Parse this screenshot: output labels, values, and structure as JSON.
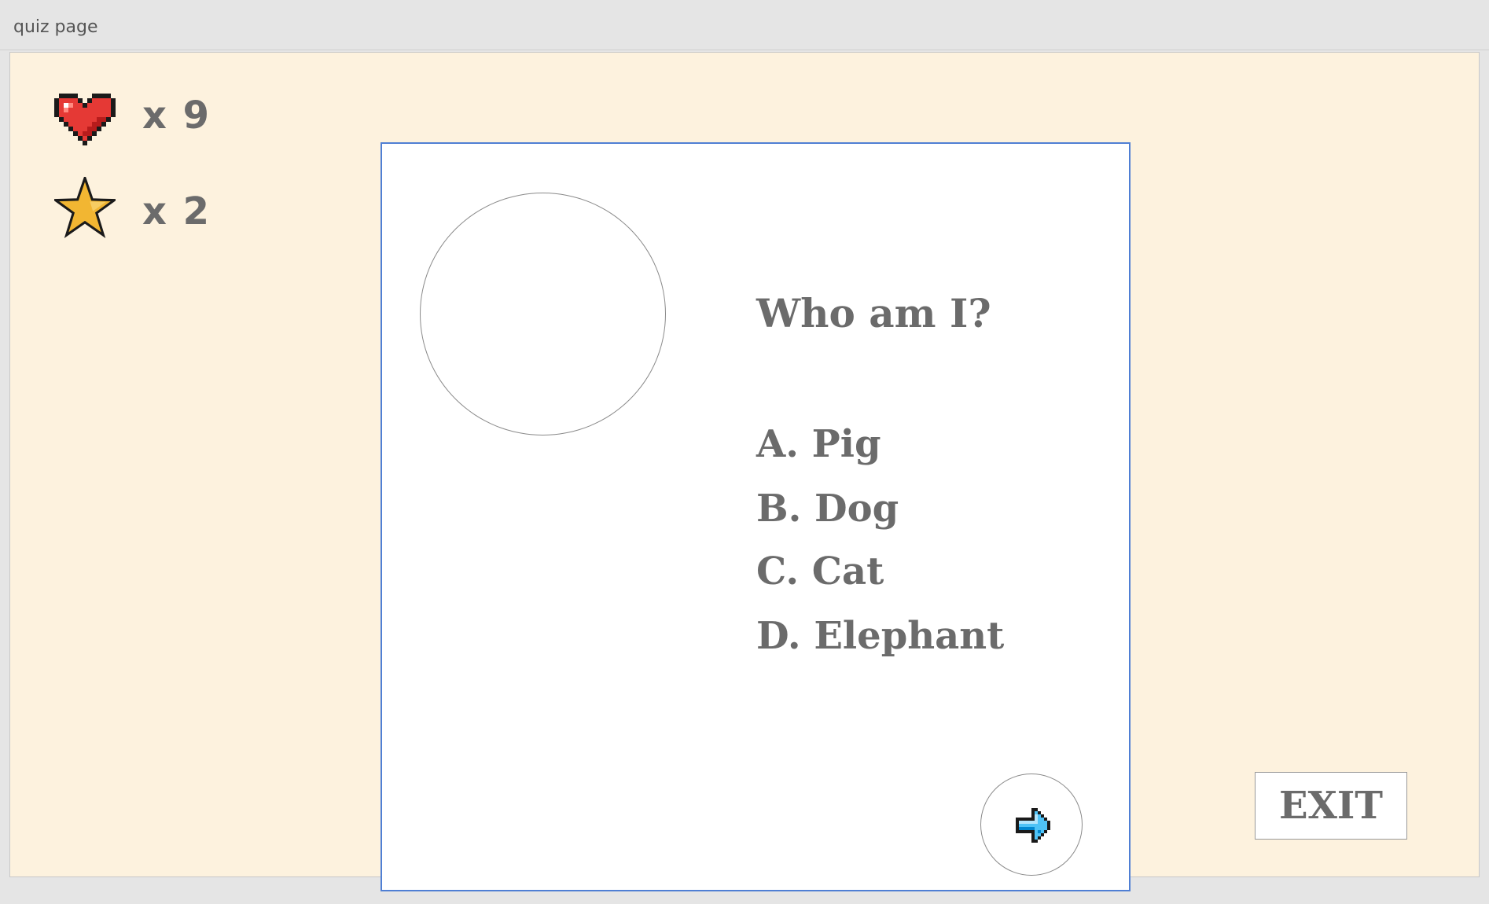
{
  "window": {
    "title": "quiz page"
  },
  "stats": {
    "hearts": {
      "icon": "heart-icon",
      "text": "x 9",
      "color": "#e53935"
    },
    "stars": {
      "icon": "star-icon",
      "text": "x 2",
      "color": "#f2b632"
    }
  },
  "quiz": {
    "question": "Who am I?",
    "options": [
      "A. Pig",
      "B. Dog",
      "C. Cat",
      "D. Elephant"
    ],
    "next_icon": "arrow-right-icon"
  },
  "exit": {
    "label": "EXIT"
  },
  "colors": {
    "background": "#fdf2de",
    "card_border": "#4f7fd4",
    "text": "#6b6b6b",
    "arrow": "#4fc3f7"
  }
}
